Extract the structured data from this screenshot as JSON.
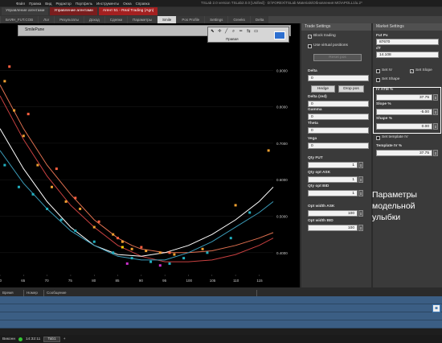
{
  "menu": {
    "items": [
      "Файл",
      "Правка",
      "Вид",
      "Редактор",
      "Портфель",
      "Инструменты",
      "Окна",
      "Справка"
    ],
    "app_title": "TSLab 2.0 version  TSLab2.0.0 [Unified] · D:\\FOREX\\TSLab Materials\\Обновления MO\\АРОLL1lu.2*"
  },
  "window_tabs": [
    "Управление агентами",
    "Управление агентами",
    "Агент 51 - Real Trading (Agn)"
  ],
  "sub_tabs": [
    {
      "label": "БАЯН_FUT.COB",
      "active": false
    },
    {
      "label": "Лог",
      "active": false
    },
    {
      "label": "Результаты",
      "active": false
    },
    {
      "label": "Доход",
      "active": false
    },
    {
      "label": "Сделки",
      "active": false
    },
    {
      "label": "Параметры",
      "active": false
    },
    {
      "label": "Smile",
      "active": true
    },
    {
      "label": "Pos Profile",
      "active": false
    },
    {
      "label": "Settings",
      "active": false
    },
    {
      "label": "Greeks",
      "active": false
    },
    {
      "label": "Delta",
      "active": false
    }
  ],
  "chart_header": {
    "title": "SmilePane"
  },
  "toolbar": {
    "label": "Правая"
  },
  "chart_data": {
    "type": "scatter",
    "title": "",
    "x_ticks": [
      "60",
      "65",
      "70",
      "75",
      "80",
      "85",
      "90",
      "95",
      "100",
      "105",
      "110",
      "115"
    ],
    "y_ticks": [
      "0.9000",
      "0.8000",
      "0.7000",
      "0.6000",
      "0.5000",
      "0.4000"
    ],
    "xlim": [
      60,
      118
    ],
    "ylim": [
      0.34,
      0.98
    ],
    "series": [
      {
        "kind": "curve",
        "color": "#e07050",
        "points": [
          [
            60,
            0.86
          ],
          [
            65,
            0.74
          ],
          [
            70,
            0.64
          ],
          [
            75,
            0.56
          ],
          [
            80,
            0.49
          ],
          [
            85,
            0.44
          ],
          [
            88,
            0.42
          ],
          [
            90,
            0.41
          ],
          [
            95,
            0.4
          ],
          [
            100,
            0.4
          ],
          [
            105,
            0.405
          ],
          [
            110,
            0.42
          ],
          [
            115,
            0.44
          ],
          [
            118,
            0.455
          ]
        ]
      },
      {
        "kind": "curve",
        "color": "#c84040",
        "points": [
          [
            60,
            0.83
          ],
          [
            65,
            0.71
          ],
          [
            70,
            0.61
          ],
          [
            75,
            0.53
          ],
          [
            80,
            0.47
          ],
          [
            85,
            0.42
          ],
          [
            90,
            0.39
          ],
          [
            95,
            0.375
          ],
          [
            100,
            0.375
          ],
          [
            105,
            0.38
          ],
          [
            110,
            0.395
          ],
          [
            115,
            0.42
          ],
          [
            118,
            0.44
          ]
        ]
      },
      {
        "kind": "curve",
        "color": "#ffffff",
        "points": [
          [
            60,
            0.74
          ],
          [
            65,
            0.63
          ],
          [
            70,
            0.54
          ],
          [
            75,
            0.47
          ],
          [
            80,
            0.42
          ],
          [
            85,
            0.395
          ],
          [
            90,
            0.39
          ],
          [
            95,
            0.4
          ],
          [
            100,
            0.42
          ],
          [
            105,
            0.45
          ],
          [
            110,
            0.49
          ],
          [
            115,
            0.54
          ],
          [
            118,
            0.58
          ]
        ]
      },
      {
        "kind": "curve",
        "color": "#3a9bb8",
        "points": [
          [
            60,
            0.68
          ],
          [
            65,
            0.59
          ],
          [
            70,
            0.52
          ],
          [
            75,
            0.46
          ],
          [
            80,
            0.42
          ],
          [
            85,
            0.39
          ],
          [
            90,
            0.38
          ],
          [
            95,
            0.38
          ],
          [
            100,
            0.4
          ],
          [
            105,
            0.43
          ],
          [
            110,
            0.47
          ],
          [
            115,
            0.51
          ],
          [
            118,
            0.54
          ]
        ]
      },
      {
        "kind": "markers",
        "color": "#f0a030",
        "points": [
          [
            61,
            0.87
          ],
          [
            63,
            0.79
          ],
          [
            65,
            0.72
          ],
          [
            68,
            0.64
          ],
          [
            71,
            0.58
          ],
          [
            74,
            0.54
          ],
          [
            77,
            0.52
          ],
          [
            80,
            0.47
          ],
          [
            84,
            0.45
          ],
          [
            86,
            0.43
          ],
          [
            88,
            0.41
          ],
          [
            91,
            0.405
          ],
          [
            94,
            0.4
          ],
          [
            97,
            0.395
          ],
          [
            103,
            0.41
          ],
          [
            110,
            0.53
          ],
          [
            117,
            0.68
          ]
        ]
      },
      {
        "kind": "markers",
        "color": "#ff6040",
        "points": [
          [
            62,
            0.91
          ],
          [
            66,
            0.78
          ],
          [
            72,
            0.63
          ],
          [
            76,
            0.55
          ],
          [
            81,
            0.485
          ],
          [
            85,
            0.44
          ],
          [
            90,
            0.415
          ],
          [
            96,
            0.4
          ]
        ]
      },
      {
        "kind": "markers",
        "color": "#20b0c0",
        "points": [
          [
            61,
            0.64
          ],
          [
            64,
            0.58
          ],
          [
            67,
            0.56
          ],
          [
            70,
            0.52
          ],
          [
            73,
            0.49
          ],
          [
            76,
            0.46
          ],
          [
            80,
            0.43
          ],
          [
            84,
            0.4
          ],
          [
            88,
            0.385
          ],
          [
            92,
            0.375
          ],
          [
            96,
            0.37
          ],
          [
            99,
            0.385
          ],
          [
            104,
            0.4
          ],
          [
            109,
            0.44
          ],
          [
            113,
            0.51
          ]
        ]
      },
      {
        "kind": "markers",
        "color": "#cc30cc",
        "points": [
          [
            87,
            0.37
          ],
          [
            94,
            0.365
          ]
        ]
      },
      {
        "kind": "markers",
        "color": "#ffd000",
        "points": [
          [
            86,
            0.415
          ]
        ]
      }
    ]
  },
  "trade_settings": {
    "header": "Trade Settings",
    "block_trading": "Block trading",
    "use_virtual": "Use virtual positions",
    "reset_pos": "Reset pos",
    "delta_label": "Delta",
    "delta_value": "0",
    "hedge": "Hedge",
    "drop_pos": "Drop pos",
    "delta_red_label": "Delta (red)",
    "delta_red_value": "0",
    "gamma_label": "Gamma",
    "gamma_value": "0",
    "theta_label": "Theta",
    "theta_value": "0",
    "vega_label": "Vega",
    "vega_value": "0",
    "qty_fut_label": "Qty FUT",
    "qty_fut_value": "1",
    "qty_ask_label": "Qty opt ASK",
    "qty_ask_value": "1",
    "qty_bid_label": "Qty opt BID",
    "qty_bid_value": "1",
    "width_ask_label": "Opt width ASK",
    "width_ask_value": "100",
    "width_bid_label": "Opt width BID",
    "width_bid_value": "100"
  },
  "market_settings": {
    "header": "Market Settings",
    "fut_px_label": "Fut Px",
    "fut_px_value": "87670",
    "dt_label": "dT",
    "dt_value": "14.108",
    "set_iv": "Set IV",
    "set_slope": "Set Slope",
    "set_shape": "Set Shape",
    "iv_atm_label": "IV ATM %",
    "iv_atm_value": "37.75",
    "slope_label": "Slope %",
    "slope_value": "-5.00",
    "shape_label": "Shape %",
    "shape_value": "0.00",
    "set_template": "Set template IV",
    "template_label": "Template IV %",
    "template_value": "37.75"
  },
  "callout": {
    "text": "Параметры модельной улыбки"
  },
  "messages": {
    "columns": [
      "Время",
      "Номер",
      "Сообщение"
    ]
  },
  "status": {
    "label": "Виконн",
    "time": "14:32:11",
    "tab": "Tab1"
  }
}
